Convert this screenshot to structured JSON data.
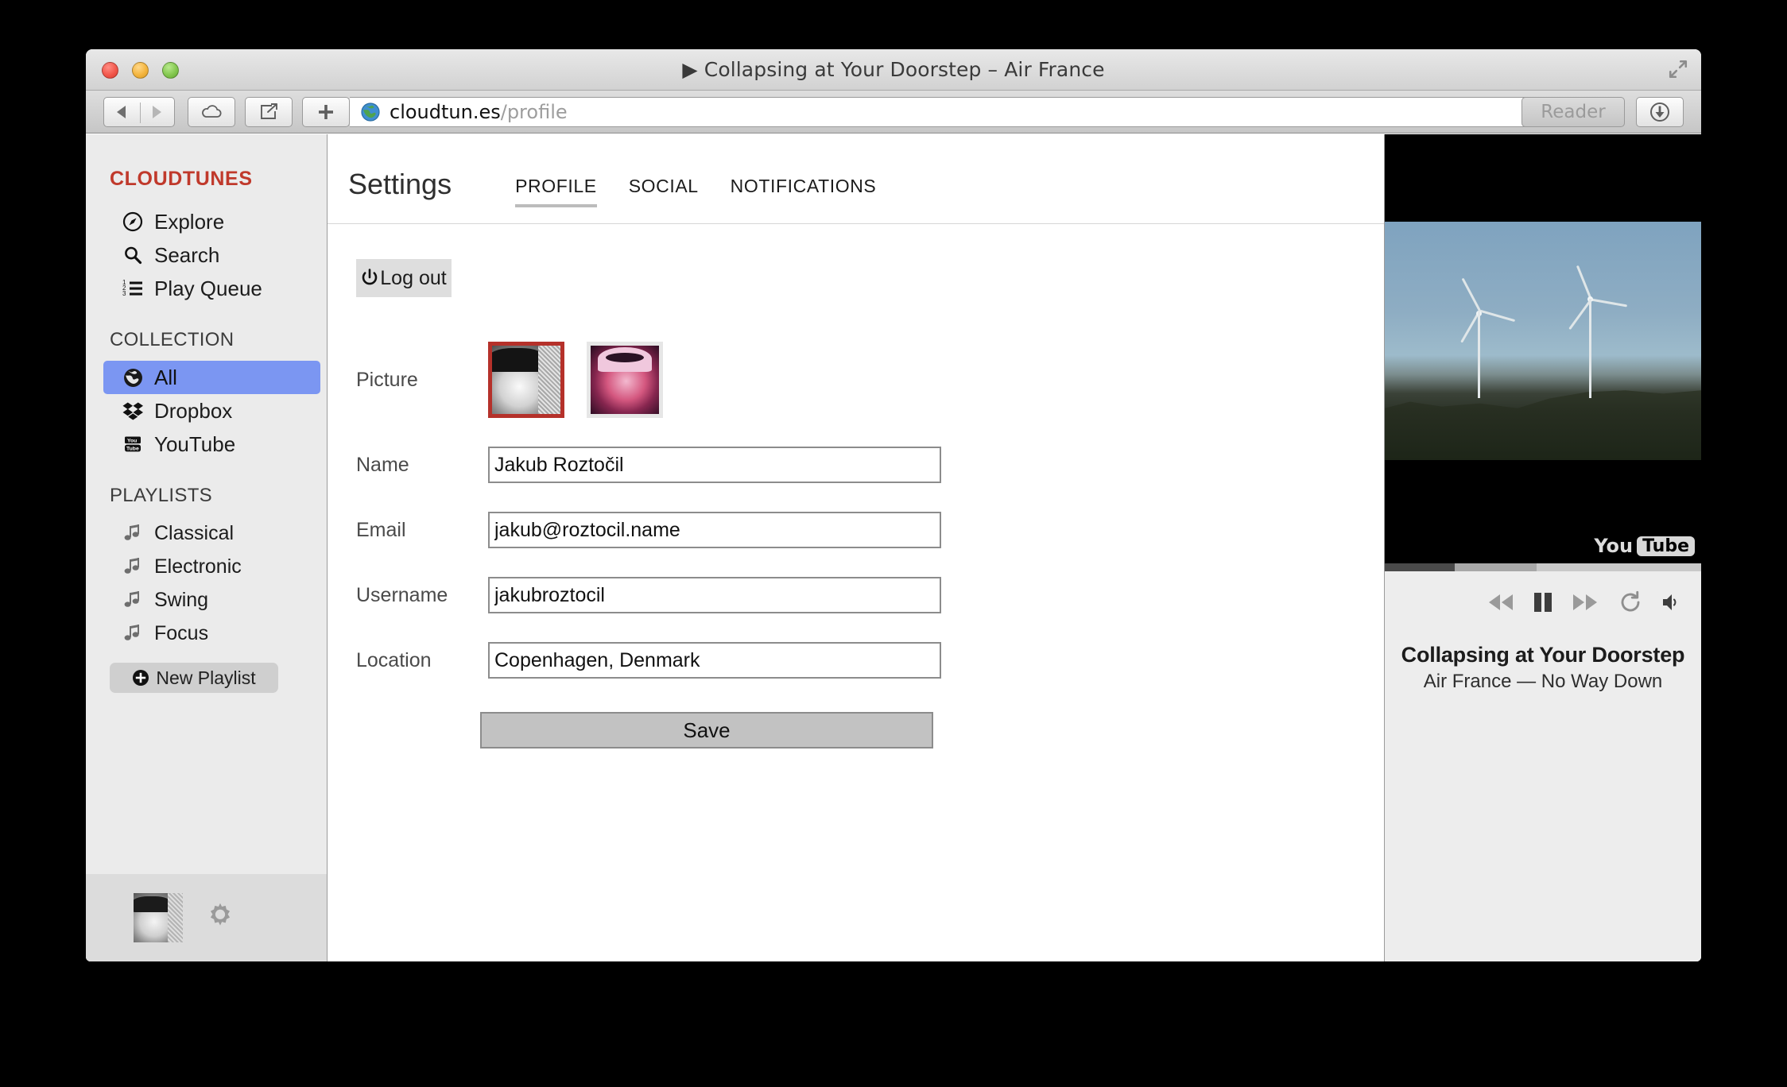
{
  "window": {
    "title": "▶ Collapsing at Your Doorstep – Air France"
  },
  "toolbar": {
    "url_host": "cloudtun.es",
    "url_path": "/profile",
    "reader_label": "Reader",
    "icons": {
      "back": "back-arrow-icon",
      "forward": "forward-arrow-icon",
      "cloud": "icloud-icon",
      "share": "share-icon",
      "new_tab": "plus-icon",
      "site": "globe-icon",
      "reload": "reload-icon",
      "download": "downloads-icon",
      "fullscreen": "fullscreen-icon"
    }
  },
  "sidebar": {
    "brand": "CLOUDTUNES",
    "nav": [
      {
        "label": "Explore",
        "icon": "compass-icon"
      },
      {
        "label": "Search",
        "icon": "search-icon"
      },
      {
        "label": "Play Queue",
        "icon": "numbered-list-icon"
      }
    ],
    "collection_heading": "COLLECTION",
    "collection": [
      {
        "label": "All",
        "icon": "globe-icon",
        "active": true
      },
      {
        "label": "Dropbox",
        "icon": "dropbox-icon",
        "active": false
      },
      {
        "label": "YouTube",
        "icon": "youtube-icon",
        "active": false
      }
    ],
    "playlists_heading": "PLAYLISTS",
    "playlists": [
      {
        "label": "Classical",
        "icon": "music-note-icon"
      },
      {
        "label": "Electronic",
        "icon": "music-note-icon"
      },
      {
        "label": "Swing",
        "icon": "music-note-icon"
      },
      {
        "label": "Focus",
        "icon": "music-note-icon"
      }
    ],
    "new_playlist_label": "New Playlist",
    "footer": {
      "avatar": "user-avatar",
      "settings_icon": "gear-icon"
    }
  },
  "main": {
    "title": "Settings",
    "tabs": [
      {
        "label": "PROFILE",
        "active": true
      },
      {
        "label": "SOCIAL",
        "active": false
      },
      {
        "label": "NOTIFICATIONS",
        "active": false
      }
    ],
    "logout_label": "Log out",
    "picture_label": "Picture",
    "pictures": [
      {
        "name": "avatar-option-1",
        "selected": true
      },
      {
        "name": "avatar-option-2",
        "selected": false
      }
    ],
    "fields": [
      {
        "label": "Name",
        "value": "Jakub Roztočil",
        "name": "name-field"
      },
      {
        "label": "Email",
        "value": "jakub@roztocil.name",
        "name": "email-field"
      },
      {
        "label": "Username",
        "value": "jakubroztocil",
        "name": "username-field"
      },
      {
        "label": "Location",
        "value": "Copenhagen, Denmark",
        "name": "location-field"
      }
    ],
    "save_label": "Save"
  },
  "player": {
    "source_badge_you": "You",
    "source_badge_tube": "Tube",
    "progress": {
      "played_pct": 22,
      "buffered_pct": 26,
      "remaining_pct": 52
    },
    "controls": [
      {
        "name": "previous-track-button",
        "icon": "rewind-icon"
      },
      {
        "name": "play-pause-button",
        "icon": "pause-icon"
      },
      {
        "name": "next-track-button",
        "icon": "fast-forward-icon"
      }
    ],
    "right_controls": [
      {
        "name": "repeat-button",
        "icon": "repeat-icon"
      },
      {
        "name": "volume-button",
        "icon": "volume-icon"
      }
    ],
    "now_playing_title": "Collapsing at Your Doorstep",
    "now_playing_subtitle": "Air France — No Way Down"
  },
  "colors": {
    "brand_red": "#c0392b",
    "selection_blue": "#7b96f2",
    "selected_thumb_border": "#b5312a"
  }
}
